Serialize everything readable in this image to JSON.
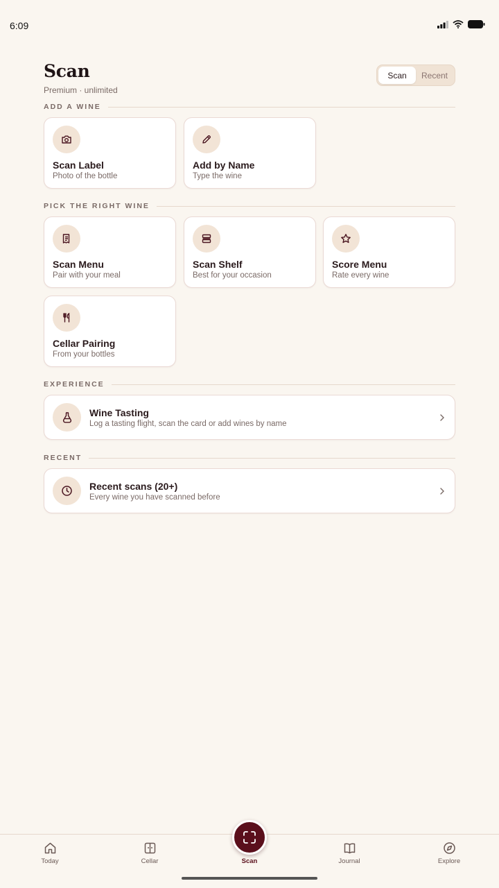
{
  "status_bar": {
    "time": "6:09"
  },
  "header": {
    "title": "Scan",
    "subtitle": "Premium · unlimited"
  },
  "segmented": {
    "options": [
      "Scan",
      "Recent"
    ],
    "selected": "Scan"
  },
  "sections": {
    "add_wine": "ADD A WINE",
    "pick_wine": "PICK THE RIGHT WINE",
    "experience": "EXPERIENCE",
    "recent": "RECENT"
  },
  "add_wine_cards": [
    {
      "title": "Scan Label",
      "subtitle": "Photo of the bottle",
      "icon": "camera-icon"
    },
    {
      "title": "Add by Name",
      "subtitle": "Type the wine",
      "icon": "pencil-icon"
    }
  ],
  "pick_cards": [
    {
      "title": "Scan Menu",
      "subtitle": "Pair with your meal",
      "icon": "menu-icon"
    },
    {
      "title": "Scan Shelf",
      "subtitle": "Best for your occasion",
      "icon": "shelf-icon"
    },
    {
      "title": "Score Menu",
      "subtitle": "Rate every wine",
      "icon": "star-icon"
    },
    {
      "title": "Cellar Pairing",
      "subtitle": "From your bottles",
      "icon": "fork-knife-icon"
    }
  ],
  "experience_card": {
    "title": "Wine Tasting",
    "subtitle": "Log a tasting flight, scan the card or add wines by name",
    "icon": "decanter-icon"
  },
  "recent_card": {
    "title": "Recent scans (20+)",
    "subtitle": "Every wine you have scanned before",
    "icon": "clock-icon"
  },
  "bottom_nav": {
    "items": [
      {
        "label": "Today",
        "icon": "home-icon"
      },
      {
        "label": "Cellar",
        "icon": "cellar-icon"
      },
      {
        "label": "Scan",
        "icon": "scan-icon"
      },
      {
        "label": "Journal",
        "icon": "book-icon"
      },
      {
        "label": "Explore",
        "icon": "compass-icon"
      }
    ],
    "active": "Scan"
  },
  "colors": {
    "background": "#faf6f0",
    "accent": "#5a0f1c",
    "icon_bg": "#f2e4d6",
    "segment_bg": "#f0e3d5"
  }
}
